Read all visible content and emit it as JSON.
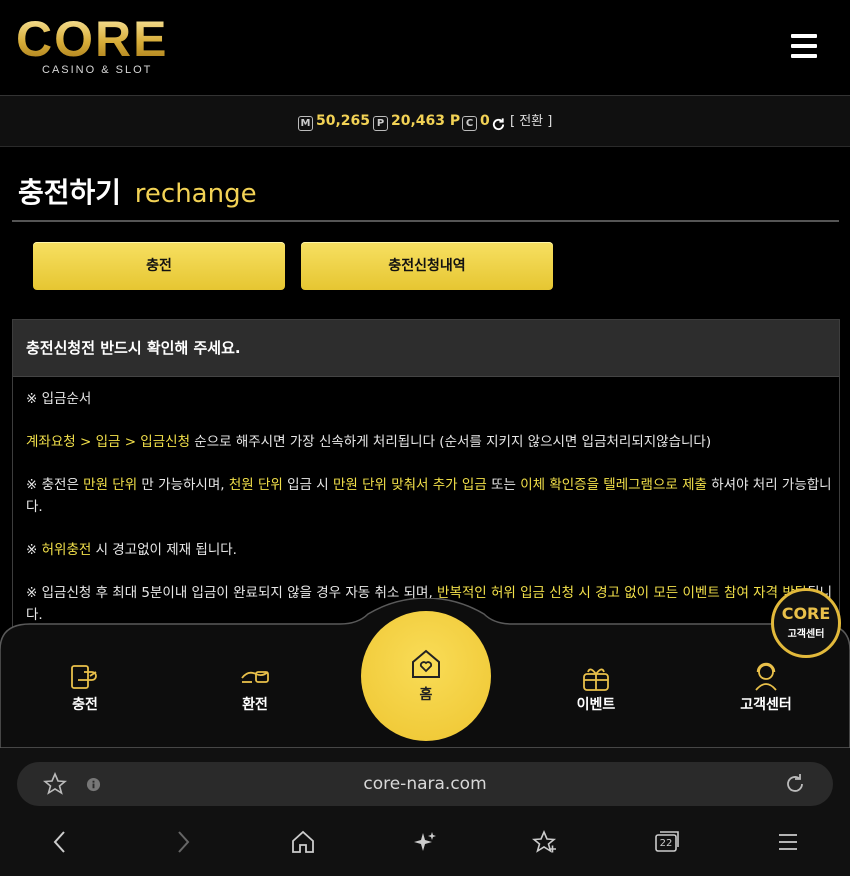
{
  "header": {
    "logo_text": "CORE",
    "logo_sub": "CASINO & SLOT"
  },
  "balance": {
    "money_icon": "M",
    "money": "50,265",
    "point_icon": "P",
    "point": "20,463 P",
    "comp_icon": "C",
    "comp": "0",
    "convert_label": "[ 전환 ]"
  },
  "page": {
    "title": "충전하기",
    "title_en": "rechange"
  },
  "tabs": [
    {
      "label": "충전"
    },
    {
      "label": "충전신청내역"
    }
  ],
  "notice": {
    "header": "충전신청전 반드시 확인해 주세요.",
    "line1": "※ 입금순서",
    "line2_hl": "계좌요청 > 입금 > 입금신청",
    "line2_rest": " 순으로 해주시면 가장 신속하게 처리됩니다 (순서를 지키지 않으시면 입금처리되지않습니다)",
    "line3_a": "※ 충전은 ",
    "line3_b": "만원 단위",
    "line3_c": " 만 가능하시며, ",
    "line3_d": "천원 단위",
    "line3_e": " 입금 시 ",
    "line3_f": "만원 단위 맞춰서 추가 입금",
    "line3_g": " 또는 ",
    "line3_h": "이체 확인증을 텔레그램으로 제출",
    "line3_i": " 하셔야 처리 가능합니다.",
    "line4_a": "※ ",
    "line4_b": "허위충전",
    "line4_c": " 시 경고없이 제재 됩니다.",
    "line5_a": "※ 입금신청 후 최대 5분이내 입금이 완료되지 않을 경우 자동 취소 되며, ",
    "line5_b": "반복적인 허위 입금 신청 시 경고 없이 모든 이벤트 참여 자격 박탈",
    "line5_c": "됩니다."
  },
  "bottom_nav": {
    "items": [
      {
        "label": "충전",
        "icon": "recharge-icon"
      },
      {
        "label": "환전",
        "icon": "exchange-icon"
      },
      {
        "label": "홈",
        "icon": "home-heart-icon"
      },
      {
        "label": "이벤트",
        "icon": "gift-icon"
      },
      {
        "label": "고객센터",
        "icon": "support-icon"
      }
    ],
    "cs_badge_logo": "CORE",
    "cs_badge_label": "고객센터"
  },
  "browser": {
    "url": "core-nara.com",
    "tab_count": "22"
  },
  "colors": {
    "accent": "#f2d255",
    "highlight_text": "#f2e04a",
    "button": "#ecca3d"
  }
}
